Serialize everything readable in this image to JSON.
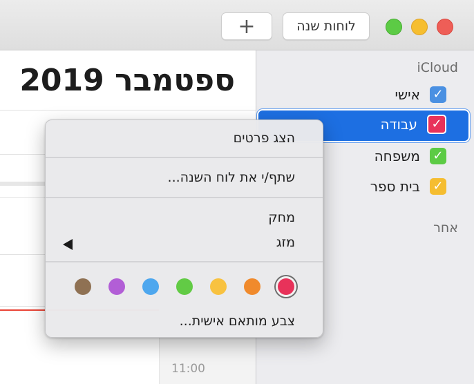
{
  "toolbar": {
    "calendars_button": "לוחות שנה",
    "add_button": "+"
  },
  "main": {
    "month_title": "ספטמבר 2019",
    "time_label": "11:00"
  },
  "sidebar": {
    "account": "iCloud",
    "calendars": [
      {
        "label": "אישי",
        "color": "#4a90e2",
        "checked": true,
        "selected": false
      },
      {
        "label": "עבודה",
        "color": "#e8325a",
        "checked": true,
        "selected": true
      },
      {
        "label": "משפחה",
        "color": "#5ccb45",
        "checked": true,
        "selected": false
      },
      {
        "label": "בית ספר",
        "color": "#f5bd30",
        "checked": true,
        "selected": false
      }
    ],
    "other_heading": "אחר"
  },
  "context_menu": {
    "show_details": "הצג פרטים",
    "share": "שתף/י את לוח השנה...",
    "delete": "מחק",
    "merge": "מזג",
    "custom_color": "צבע מותאם אישית...",
    "colors": [
      {
        "name": "red",
        "hex": "#e8325a",
        "selected": true
      },
      {
        "name": "orange",
        "hex": "#f08a2c"
      },
      {
        "name": "yellow",
        "hex": "#f8c240"
      },
      {
        "name": "green",
        "hex": "#62cb45"
      },
      {
        "name": "blue",
        "hex": "#4ea7ee"
      },
      {
        "name": "purple",
        "hex": "#b25ed6"
      },
      {
        "name": "brown",
        "hex": "#8f7153"
      }
    ]
  }
}
